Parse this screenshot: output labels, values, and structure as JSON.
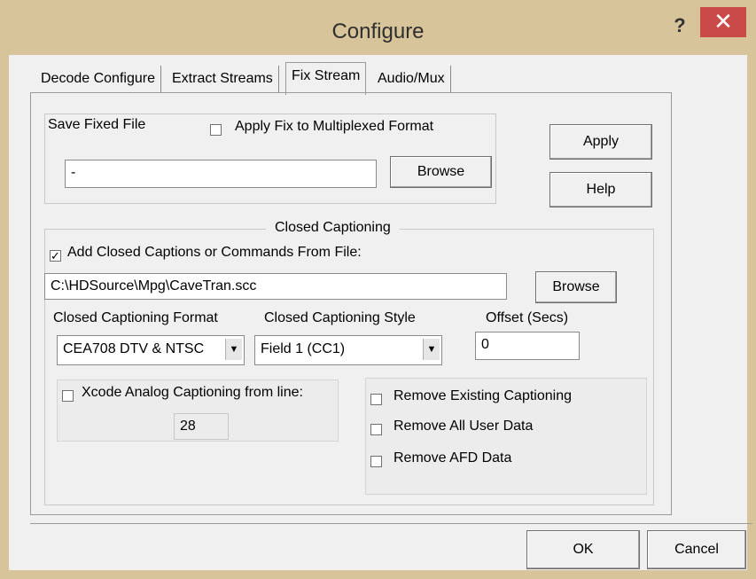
{
  "window": {
    "title": "Configure",
    "help_glyph": "?",
    "close_glyph": "✕"
  },
  "tabs": [
    {
      "label": "Decode Configure"
    },
    {
      "label": "Extract Streams"
    },
    {
      "label": "Fix Stream"
    },
    {
      "label": "Audio/Mux"
    }
  ],
  "save_fixed": {
    "group_label": "Save Fixed File",
    "apply_fix_label": "Apply Fix to Multiplexed Format",
    "apply_fix_checked": false,
    "file_value": "-",
    "browse_label": "Browse"
  },
  "side_buttons": {
    "apply": "Apply",
    "help": "Help"
  },
  "closed_captioning": {
    "group_label": "Closed Captioning",
    "add_cc_label": "Add Closed Captions or Commands From File:",
    "add_cc_checked": true,
    "file_value": "C:\\HDSource\\Mpg\\CaveTran.scc",
    "browse_label": "Browse",
    "format_label": "Closed Captioning Format",
    "format_value": "CEA708 DTV & NTSC",
    "style_label": "Closed Captioning Style",
    "style_value": "Field 1 (CC1)",
    "offset_label": "Offset (Secs)",
    "offset_value": "0",
    "xcode_label": "Xcode Analog Captioning from line:",
    "xcode_checked": false,
    "xcode_line": "28",
    "remove_existing_label": "Remove Existing Captioning",
    "remove_all_user_label": "Remove All User Data",
    "remove_afd_label": "Remove AFD Data"
  },
  "dialog_buttons": {
    "ok": "OK",
    "cancel": "Cancel"
  },
  "check_glyph": "✓",
  "combo_arrow_glyph": "▼"
}
